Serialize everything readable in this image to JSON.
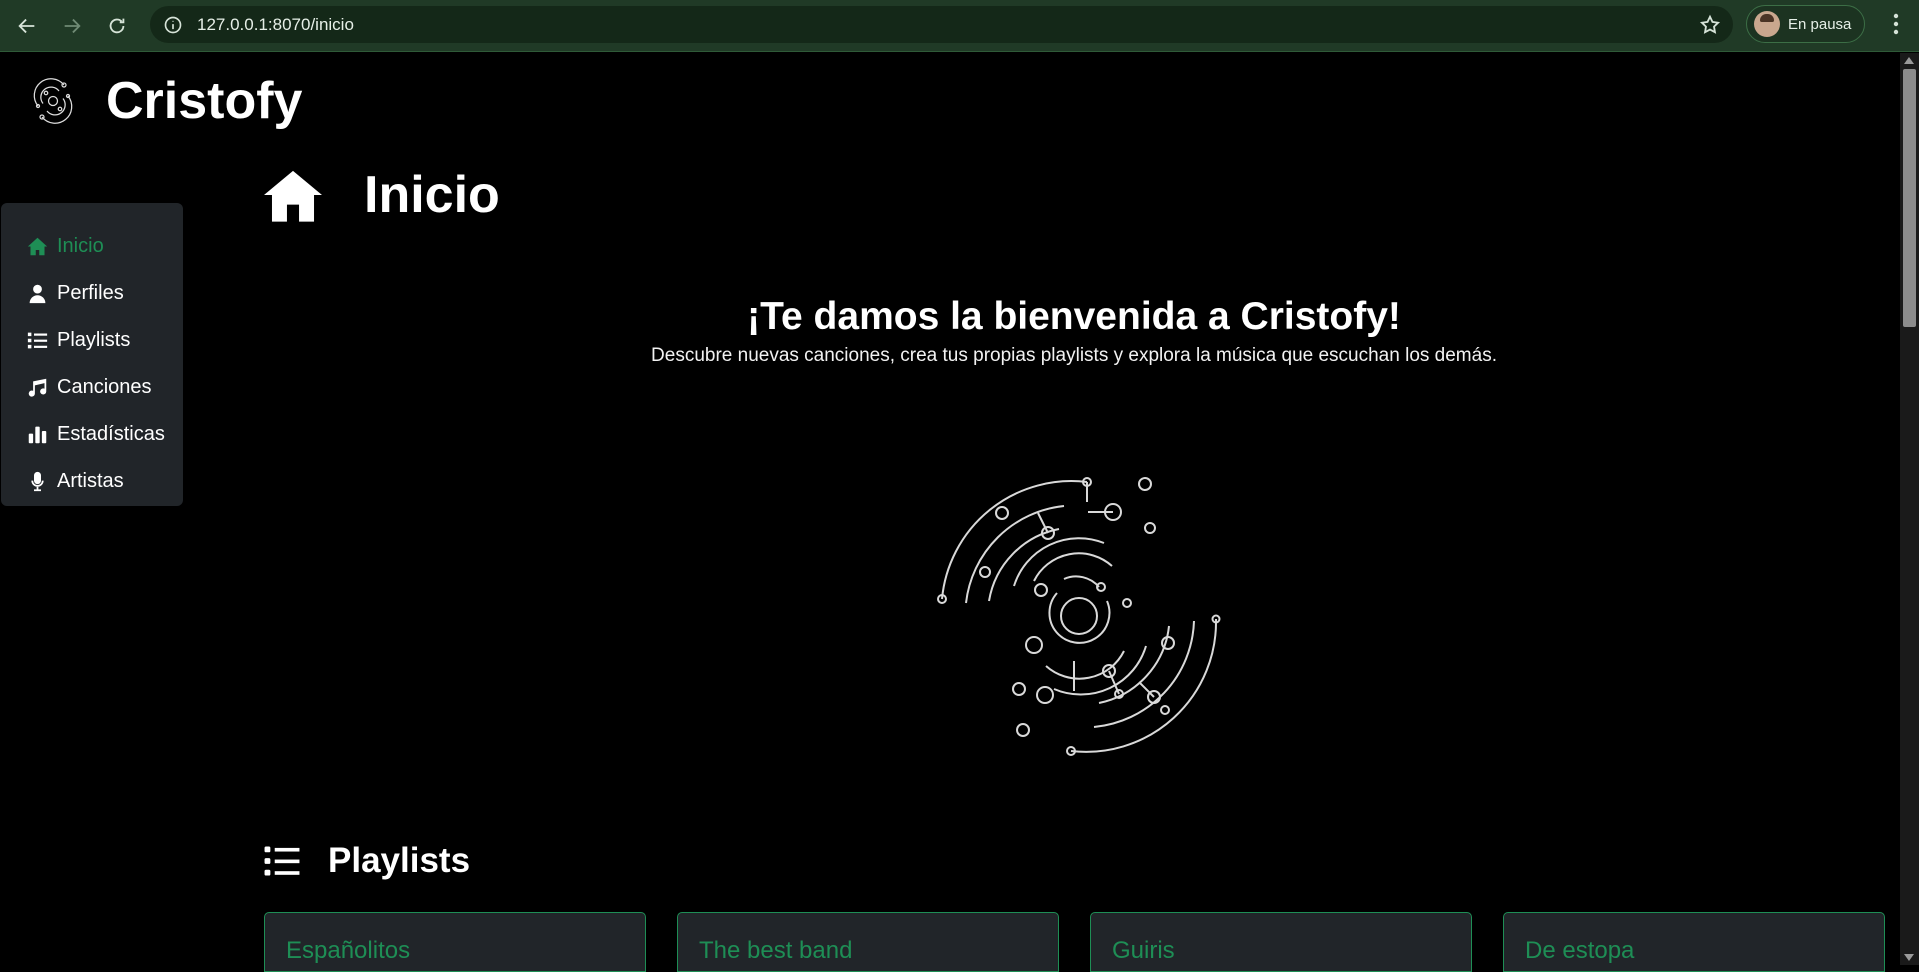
{
  "browser": {
    "url": "127.0.0.1:8070/inicio",
    "profile_label": "En pausa",
    "icons": [
      "back-icon",
      "forward-icon",
      "reload-icon",
      "info-icon",
      "star-icon",
      "kebab-icon"
    ]
  },
  "app": {
    "name": "Cristofy"
  },
  "sidebar": {
    "items": [
      {
        "label": "Inicio",
        "icon": "home-icon",
        "active": true
      },
      {
        "label": "Perfiles",
        "icon": "user-icon",
        "active": false
      },
      {
        "label": "Playlists",
        "icon": "list-icon",
        "active": false
      },
      {
        "label": "Canciones",
        "icon": "music-note-icon",
        "active": false
      },
      {
        "label": "Estadísticas",
        "icon": "bar-chart-icon",
        "active": false
      },
      {
        "label": "Artistas",
        "icon": "microphone-icon",
        "active": false
      }
    ]
  },
  "main": {
    "title": "Inicio",
    "welcome_heading": "¡Te damos la bienvenida a Cristofy!",
    "welcome_text": "Descubre nuevas canciones, crea tus propias playlists y explora la música que escuchan los demás.",
    "playlists_title": "Playlists",
    "playlists": [
      {
        "name": "Españolitos"
      },
      {
        "name": "The best band"
      },
      {
        "name": "Guiris"
      },
      {
        "name": "De estopa"
      }
    ]
  },
  "colors": {
    "accent": "#1e8e55",
    "sidebar_bg": "#212529",
    "chrome_bg": "#203a26"
  }
}
